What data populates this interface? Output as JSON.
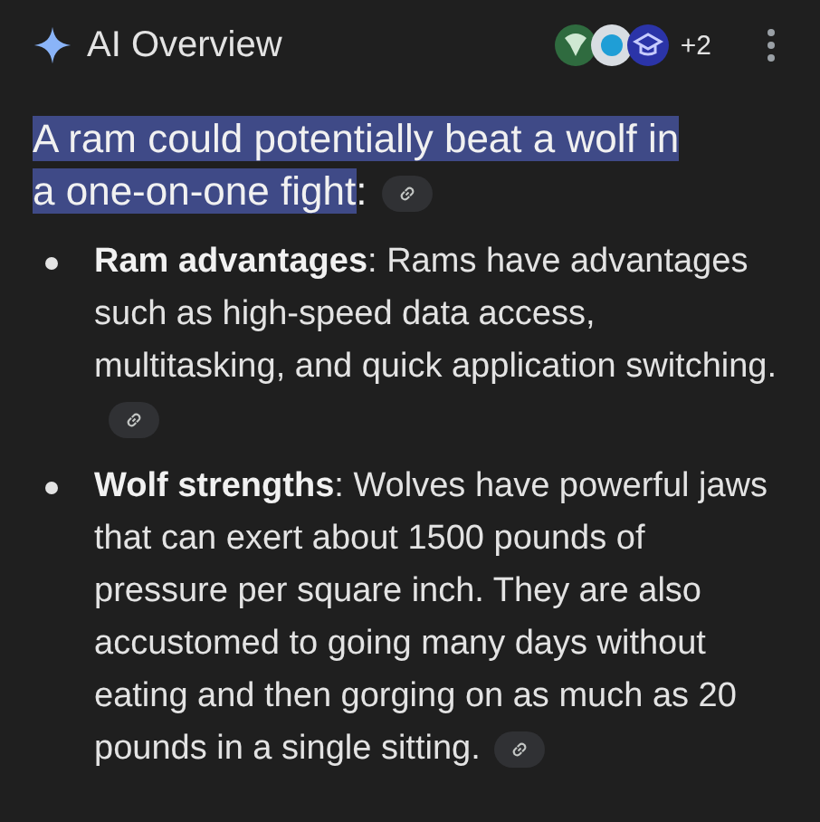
{
  "header": {
    "title": "AI Overview",
    "sources": [
      {
        "kind": "ram"
      },
      {
        "kind": "ring"
      },
      {
        "kind": "cap"
      }
    ],
    "source_count": "+2"
  },
  "lead": {
    "text": "A ram could potentially beat a wolf in a one-on-one fight",
    "suffix": ":",
    "highlighted": true
  },
  "bullets": [
    {
      "text": "**Ram advantages**: Rams have advantages such as high-speed data access, multitasking, and quick application switching."
    },
    {
      "text": "**Wolf strengths**: Wolves have powerful jaws that can exert about 1500 pounds of pressure per square inch. They are also accustomed to going many days without eating and then gorging on as much as 20 pounds in a single sitting."
    }
  ]
}
